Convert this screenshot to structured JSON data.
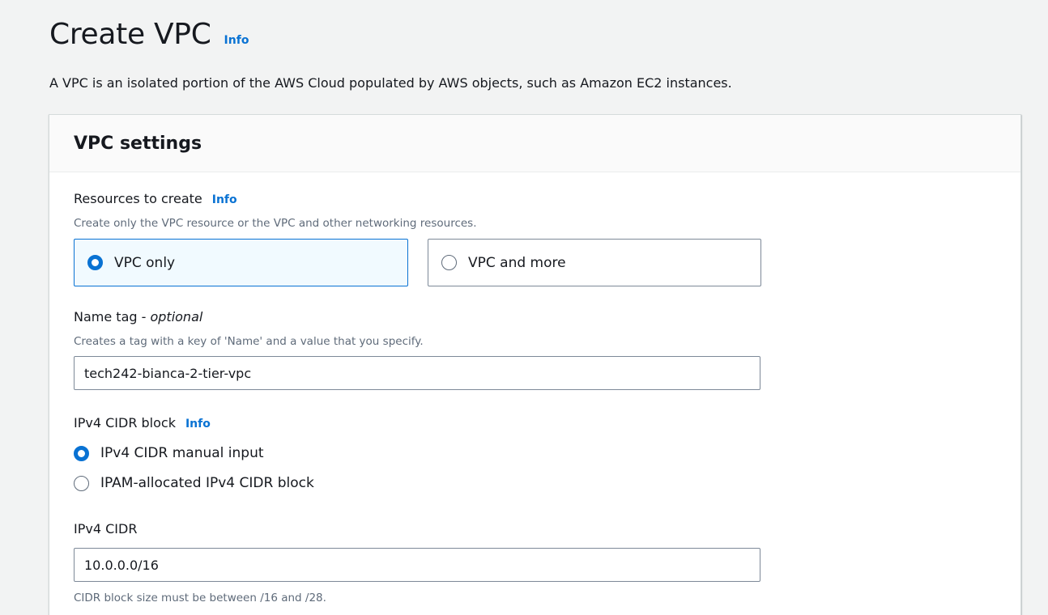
{
  "page": {
    "title": "Create VPC",
    "title_info": "Info",
    "description": "A VPC is an isolated portion of the AWS Cloud populated by AWS objects, such as Amazon EC2 instances."
  },
  "panel": {
    "title": "VPC settings",
    "resources": {
      "label": "Resources to create",
      "info": "Info",
      "description": "Create only the VPC resource or the VPC and other networking resources.",
      "options": [
        {
          "label": "VPC only",
          "selected": true
        },
        {
          "label": "VPC and more",
          "selected": false
        }
      ]
    },
    "name_tag": {
      "label": "Name tag - ",
      "optional": "optional",
      "description": "Creates a tag with a key of 'Name' and a value that you specify.",
      "value": "tech242-bianca-2-tier-vpc"
    },
    "ipv4_block": {
      "label": "IPv4 CIDR block",
      "info": "Info",
      "options": [
        {
          "label": "IPv4 CIDR manual input",
          "selected": true
        },
        {
          "label": "IPAM-allocated IPv4 CIDR block",
          "selected": false
        }
      ]
    },
    "ipv4_cidr": {
      "label": "IPv4 CIDR",
      "value": "10.0.0.0/16",
      "hint": "CIDR block size must be between /16 and /28."
    }
  },
  "colors": {
    "accent": "#0972d3",
    "background": "#f2f3f3",
    "selected_tile_bg": "#f1faff"
  }
}
